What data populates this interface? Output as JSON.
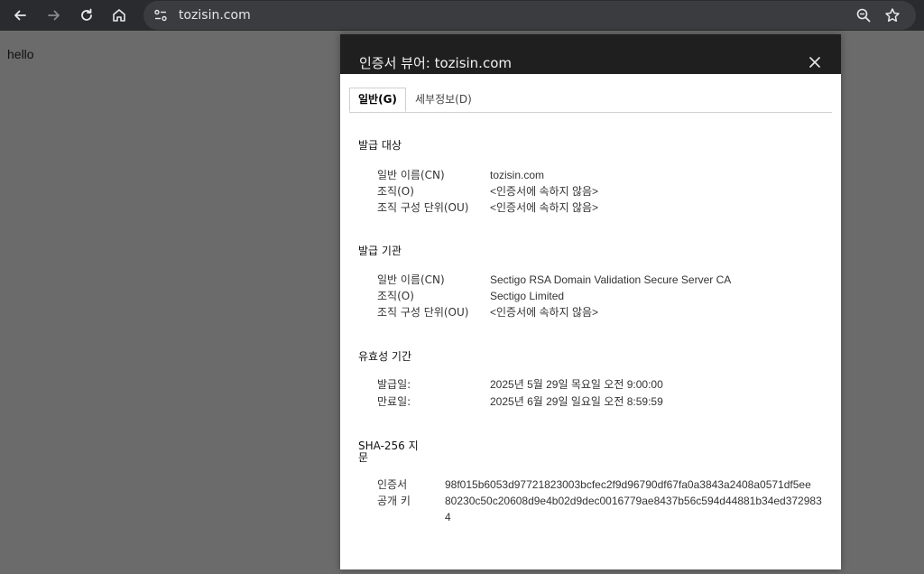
{
  "browser": {
    "url": "tozisin.com",
    "icons": {
      "back": "back-arrow-icon",
      "forward": "forward-arrow-icon",
      "reload": "reload-icon",
      "home": "home-icon",
      "site_info": "site-info-icon",
      "zoom": "zoom-icon",
      "bookmark": "star-icon"
    }
  },
  "page": {
    "text": "hello"
  },
  "dialog": {
    "title": "인증서 뷰어: tozisin.com",
    "tabs": [
      {
        "label": "일반(G)",
        "active": true
      },
      {
        "label": "세부정보(D)",
        "active": false
      }
    ],
    "issued_to": {
      "title": "발급 대상",
      "rows": [
        {
          "label": "일반 이름(CN)",
          "value": "tozisin.com"
        },
        {
          "label": "조직(O)",
          "value": "<인증서에 속하지 않음>"
        },
        {
          "label": "조직 구성 단위(OU)",
          "value": "<인증서에 속하지 않음>"
        }
      ]
    },
    "issued_by": {
      "title": "발급 기관",
      "rows": [
        {
          "label": "일반 이름(CN)",
          "value": "Sectigo RSA Domain Validation Secure Server CA"
        },
        {
          "label": "조직(O)",
          "value": "Sectigo Limited"
        },
        {
          "label": "조직 구성 단위(OU)",
          "value": "<인증서에 속하지 않음>"
        }
      ]
    },
    "validity": {
      "title": "유효성 기간",
      "rows": [
        {
          "label": "발급일:",
          "value": "2025년 5월 29일 목요일 오전 9:00:00"
        },
        {
          "label": "만료일:",
          "value": "2025년 6월 29일 일요일 오전 8:59:59"
        }
      ]
    },
    "fingerprints": {
      "title_line1": "SHA-256 지",
      "title_line2": "문",
      "rows": [
        {
          "label": "인증서",
          "value": "98f015b6053d97721823003bcfec2f9d96790df67fa0a3843a2408a0571df5ee"
        },
        {
          "label": "공개 키",
          "value": "80230c50c20608d9e4b02d9dec0016779ae8437b56c594d44881b34ed372983 4"
        }
      ]
    }
  },
  "colors": {
    "toolbar_bg": "#2a2b2f",
    "omnibox_bg": "#3b3c40",
    "overlay_bg": "#6b6b6b",
    "dialog_header_bg": "#1f1f1f"
  }
}
